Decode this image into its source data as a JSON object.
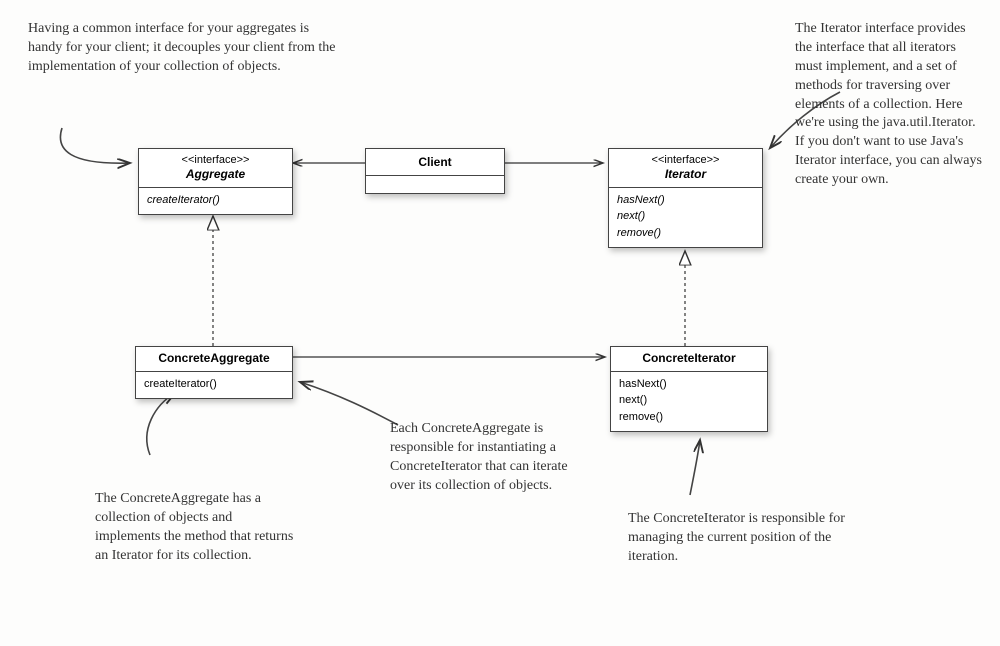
{
  "boxes": {
    "aggregate": {
      "stereo": "<<interface>>",
      "name": "Aggregate",
      "methods": [
        "createIterator()"
      ]
    },
    "client": {
      "name": "Client"
    },
    "iterator": {
      "stereo": "<<interface>>",
      "name": "Iterator",
      "methods": [
        "hasNext()",
        "next()",
        "remove()"
      ]
    },
    "concreteAggregate": {
      "name": "ConcreteAggregate",
      "methods": [
        "createIterator()"
      ]
    },
    "concreteIterator": {
      "name": "ConcreteIterator",
      "methods": [
        "hasNext()",
        "next()",
        "remove()"
      ]
    }
  },
  "annotations": {
    "topLeft": "Having a common interface for your aggregates is handy for your client; it decouples your client from the implementation of your collection of objects.",
    "topRight": "The Iterator interface provides the interface that all iterators must implement, and a set of methods for traversing over elements of a collection. Here we're using the java.util.Iterator. If you don't want to use Java's Iterator interface, you can always create your own.",
    "bottomLeft": "The ConcreteAggregate has a collection of objects and implements the method that returns an Iterator for its collection.",
    "bottomMiddle": "Each ConcreteAggregate is responsible for instantiating a ConcreteIterator that can iterate over its collection of objects.",
    "bottomRight": "The ConcreteIterator is responsible for managing the current position of the iteration."
  }
}
